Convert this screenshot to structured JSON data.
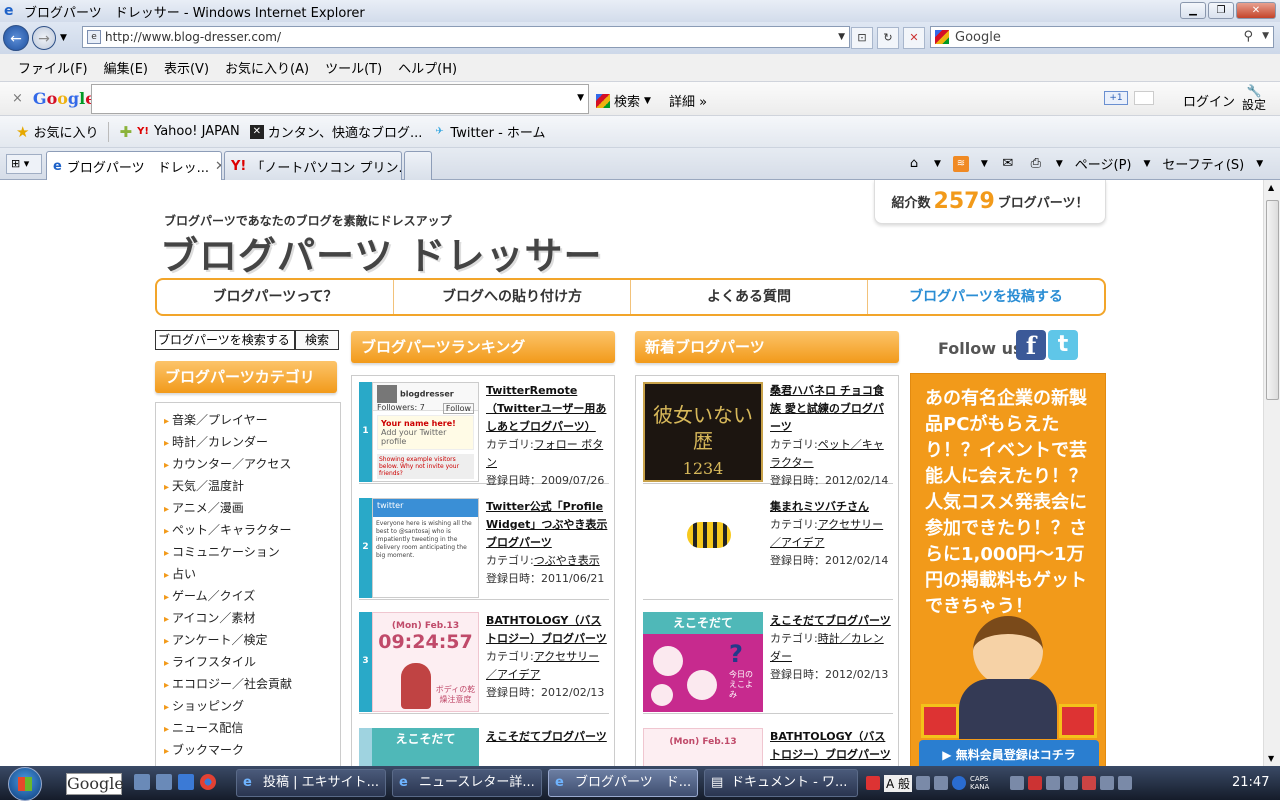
{
  "window": {
    "title": "ブログパーツ　ドレッサー - Windows Internet Explorer",
    "url": "http://www.blog-dresser.com/",
    "search_engine": "Google"
  },
  "menubar": [
    "ファイル(F)",
    "編集(E)",
    "表示(V)",
    "お気に入り(A)",
    "ツール(T)",
    "ヘルプ(H)"
  ],
  "google_toolbar": {
    "close": "×",
    "logo": [
      "G",
      "o",
      "o",
      "g",
      "l",
      "e"
    ],
    "search_button": "検索",
    "detail": "詳細 »",
    "plus_one": "+1",
    "login": "ログイン",
    "settings": "設定"
  },
  "favorites": {
    "label": "お気に入り",
    "items": [
      "Yahoo! JAPAN",
      "カンタン、快適なブログ...",
      "Twitter - ホーム"
    ]
  },
  "tabs": {
    "active": "ブログパーツ　ドレッ...",
    "inactive": "「ノートパソコン プリン...",
    "cmd": [
      "ページ(P)",
      "セーフティ(S)"
    ]
  },
  "site": {
    "tagline": "ブログパーツであなたのブログを素敵にドレスアップ",
    "logo": "ブログパーツ ドレッサー",
    "count_label": "紹介数",
    "count_value": "2579",
    "count_suffix": "ブログパーツ！",
    "nav": [
      "ブログパーツって？",
      "ブログへの貼り付け方",
      "よくある質問",
      "ブログパーツを投稿する"
    ],
    "search_placeholder": "ブログパーツを検索する",
    "search_button": "検索",
    "category_head": "ブログパーツカテゴリ",
    "categories": [
      "音楽／プレイヤー",
      "時計／カレンダー",
      "カウンター／アクセス",
      "天気／温度計",
      "アニメ／漫画",
      "ペット／キャラクター",
      "コミュニケーション",
      "占い",
      "ゲーム／クイズ",
      "アイコン／素材",
      "アンケート／検定",
      "ライフスタイル",
      "エコロジー／社会貢献",
      "ショッピング",
      "ニュース配信",
      "ブックマーク"
    ],
    "ranking_head": "ブログパーツランキング",
    "new_head": "新着ブログパーツ",
    "follow": "Follow us",
    "cat_label": "カテゴリ:",
    "date_label": "登録日時：",
    "ranking": [
      {
        "rank": "1",
        "title": "TwitterRemote（Twitterユーザー用あしあとブログパーツ）",
        "category": "フォロー ボタン",
        "date": "2009/07/26"
      },
      {
        "rank": "2",
        "title": "Twitter公式「Profile Widget」つぶやき表示ブログパーツ",
        "category": "つぶやき表示",
        "date": "2011/06/21"
      },
      {
        "rank": "3",
        "title": "BATHTOLOGY（バストロジー）ブログパーツ",
        "category": "アクセサリー／アイデア",
        "date": "2012/02/13"
      },
      {
        "rank": "",
        "title": "えこそだてブログパーツ",
        "category": "",
        "date": ""
      }
    ],
    "newest": [
      {
        "title": "桑君ハバネロ チョコ食族 愛と試練のブログパーツ",
        "category": "ペット／キャラクター",
        "date": "2012/02/14"
      },
      {
        "title": "集まれミツバチさん",
        "category": "アクセサリー／アイデア",
        "date": "2012/02/14"
      },
      {
        "title": "えこそだてブログパーツ",
        "category": "時計／カレンダー",
        "date": "2012/02/13"
      },
      {
        "title": "BATHTOLOGY（バストロジー）ブログパーツ",
        "category": "",
        "date": ""
      }
    ],
    "thumbs": {
      "tw1_name": "blogdresser",
      "tw1_followers": "Followers: 7",
      "tw1_follow": "Follow",
      "tw1_yourname": "Your name here!",
      "tw1_sub": "Add your Twitter profile",
      "tw1_ex": "Showing example visitors below. Why not invite your friends?",
      "tw2_head": "twitter",
      "tw2_body": "Everyone here is wishing all the best to @santosaj who is impatiently tweeting in the delivery room anticipating the big moment.",
      "bath_date": "(Mon) Feb.13",
      "bath_time": "09:24:57",
      "bath_text": "ボディの乾燥注意度",
      "kano_text": "彼女いない歴",
      "kano_num": "1234",
      "eko_head": "えこそだて",
      "eko_text": "今日のえこよみ"
    },
    "ad": {
      "text": "あの有名企業の新製品PCがもらえたり！？イベントで芸能人に会えたり！？人気コスメ発表会に参加できたり！？さらに1,000円〜1万円の掲載料もゲットできちゃう！",
      "button": "▶ 無料会員登録はコチラ"
    }
  },
  "taskbar": {
    "google": "Google",
    "tasks": [
      "投稿 | エキサイト...",
      "ニュースレター詳...",
      "ブログパーツ　ド...",
      "ドキュメント - ワ..."
    ],
    "ime": "A 般",
    "caps": "CAPS KANA",
    "clock": "21:47"
  },
  "colors": {
    "accent": "#f29a1a",
    "link_blue": "#2a8dd4",
    "rank_teal": "#29a9c8"
  }
}
